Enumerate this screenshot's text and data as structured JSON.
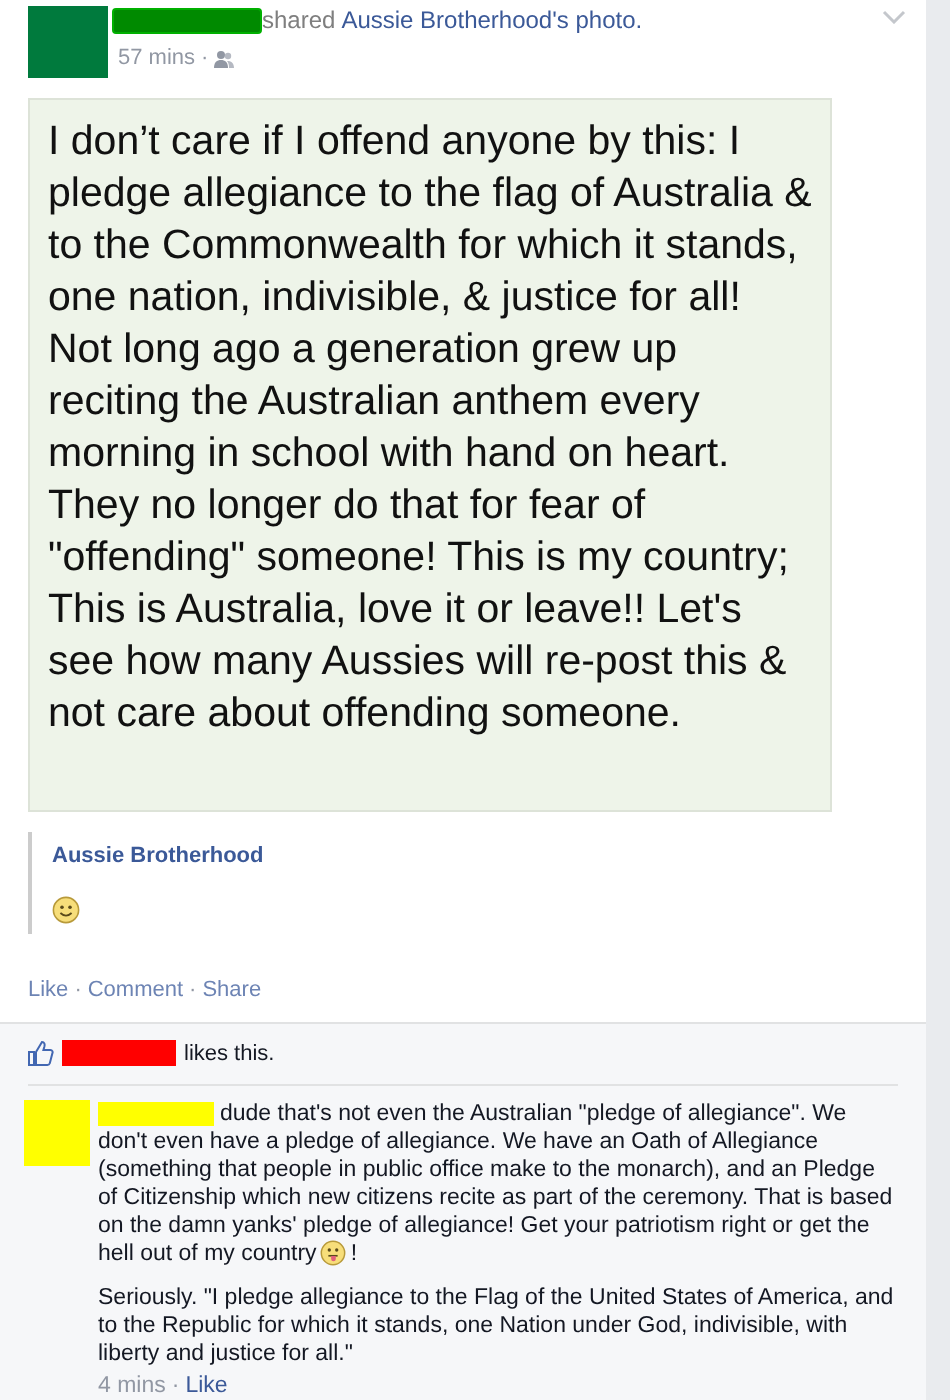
{
  "post": {
    "action": "shared",
    "shared_link": "Aussie Brotherhood's photo.",
    "time": "57 mins",
    "separator": "·",
    "image_text": "I don’t care if I offend anyone by this: I pledge allegiance to the flag of Australia & to the Commonwealth for which it stands, one nation, indivisible, & justice for all! Not long ago a generation grew up reciting the Australian anthem every morning in school with hand on heart. They no longer do that for fear of \"offending\" someone! This is my country; This is Australia, love it or leave!! Let's see how many Aussies will re-post this & not care about offending someone.",
    "caption_author": "Aussie Brotherhood",
    "actions": [
      "Like",
      "Comment",
      "Share"
    ]
  },
  "likes": {
    "text": "likes this."
  },
  "comment": {
    "text": "dude that's not even the Australian \"pledge of allegiance\". We don't even have a pledge of allegiance. We have an Oath of Allegiance (something that people in public office make to the monarch), and an Pledge of Citizenship which new citizens recite as part of the ceremony. That is based on the damn yanks' pledge of allegiance! Get your patriotism right or get the hell out of my country",
    "text_end": "!",
    "second_paragraph": "Seriously. \"I pledge allegiance to the Flag of the United States of America, and to the Republic for which it stands, one Nation under God, indivisible, with liberty and justice for all.\"",
    "time": "4 mins",
    "action": "Like"
  }
}
